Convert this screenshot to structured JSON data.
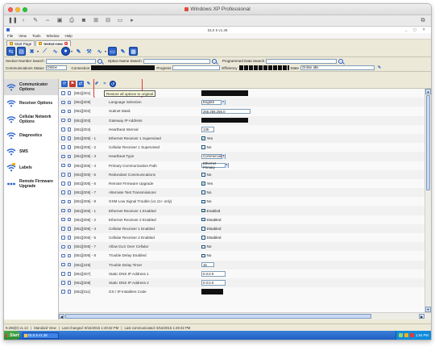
{
  "mac": {
    "title": "Windows XP Professional"
  },
  "app": {
    "title": "DLS 5 v1.38"
  },
  "menu": [
    "File",
    "View",
    "Tools",
    "Window",
    "Help"
  ],
  "tabs": [
    {
      "label": "Start Page"
    },
    {
      "label": "testo2-new"
    }
  ],
  "search": {
    "section_label": "Section Number Search",
    "option_label": "Option Name Search",
    "programmed_label": "Programmed Data Search"
  },
  "statusline": {
    "comm_label": "Communications Status",
    "comm_value": "Online",
    "connection_label": "Connection",
    "progress_label": "Progress",
    "efficiency_label": "Efficiency",
    "state_label": "State",
    "state_value": "Online Idle"
  },
  "sidebar": {
    "items": [
      {
        "label": "Communicator Options"
      },
      {
        "label": "Receiver Options"
      },
      {
        "label": "Cellular Network Options"
      },
      {
        "label": "Diagnostics"
      },
      {
        "label": "SMS"
      },
      {
        "label": "Labels"
      },
      {
        "label": "Remote Firmware Upgrade"
      }
    ]
  },
  "tooltip": "Restore all options to original",
  "rows": [
    {
      "id": "[851][001]",
      "name": "Static IP Address",
      "type": "redact"
    },
    {
      "id": "[851][009]",
      "name": "Language Selection",
      "type": "dropdown",
      "value": "English"
    },
    {
      "id": "[851][002]",
      "name": "Subnet Mask",
      "type": "text",
      "value": "255.255.255.0"
    },
    {
      "id": "[851][003]",
      "name": "Gateway IP Address",
      "type": "redact"
    },
    {
      "id": "[851][004]",
      "name": "Heartbeat Interval",
      "type": "text-short",
      "value": "135"
    },
    {
      "id": "[851][005] - 1",
      "name": "Ethernet Receiver 1 Supervised",
      "type": "check",
      "checked": "✔",
      "value": "Yes"
    },
    {
      "id": "[851][005] - 2",
      "name": "Cellular Receiver 1 Supervised",
      "type": "check",
      "checked": "",
      "value": "No"
    },
    {
      "id": "[851][005] - 3",
      "name": "Heartbeat Type",
      "type": "dropdown",
      "value": "Commercial"
    },
    {
      "id": "[851][005] - 4",
      "name": "Primary Communication Path",
      "type": "dropdown",
      "value": "Ethernet Primary"
    },
    {
      "id": "[851][005] - 5",
      "name": "Redundant Communications",
      "type": "check",
      "checked": "",
      "value": "No"
    },
    {
      "id": "[851][005] - 6",
      "name": "Remote Firmware Upgrade",
      "type": "check",
      "checked": "✔",
      "value": "Yes"
    },
    {
      "id": "[851][005] - 7",
      "name": "Alternate Test Transmissions",
      "type": "check",
      "checked": "",
      "value": "No"
    },
    {
      "id": "[851][005] - 8",
      "name": "GSM Low Signal Trouble (v1.11+ only)",
      "type": "check",
      "checked": "",
      "value": "No"
    },
    {
      "id": "[851][006] - 1",
      "name": "Ethernet Receiver 1 Enabled",
      "type": "check",
      "checked": "✔",
      "value": "Enabled"
    },
    {
      "id": "[851][006] - 2",
      "name": "Ethernet Receiver 2 Enabled",
      "type": "check",
      "checked": "",
      "value": "Disabled"
    },
    {
      "id": "[851][006] - 4",
      "name": "Cellular Receiver 1 Enabled",
      "type": "check",
      "checked": "",
      "value": "Disabled"
    },
    {
      "id": "[851][006] - 5",
      "name": "Cellular Receiver 2 Enabled",
      "type": "check",
      "checked": "",
      "value": "Disabled"
    },
    {
      "id": "[851][006] - 7",
      "name": "Allow DLS Over Cellular",
      "type": "check",
      "checked": "",
      "value": "No"
    },
    {
      "id": "[851][006] - 8",
      "name": "Trouble Delay Enabled",
      "type": "check",
      "checked": "",
      "value": "No"
    },
    {
      "id": "[851][226]",
      "name": "Trouble Delay Timer",
      "type": "text-short",
      "value": "15"
    },
    {
      "id": "[851][007]",
      "name": "Static DNS IP Address 1",
      "type": "text-mid",
      "value": "0.0.0.0"
    },
    {
      "id": "[851][008]",
      "name": "Static DNS IP Address 2",
      "type": "text-mid",
      "value": "0.0.0.0"
    },
    {
      "id": "[851][011]",
      "name": "GS / IP Installers Code",
      "type": "redact-short"
    }
  ],
  "statusbar": {
    "version": "9.265(0) v1.13",
    "view": "Standard View",
    "last_changed": "Last changed: 9/15/2015 1:49:32 PM",
    "last_communicated": "Last communicated: 9/15/2015 1:49:32 PM"
  },
  "taskbar": {
    "start": "Start",
    "task": "DLS 5 v1.38",
    "clock": "1:54 PM"
  },
  "colors": {
    "accent": "#2a62c9",
    "highlight": "#e03a33",
    "taskbar": "#1f5ec2"
  }
}
